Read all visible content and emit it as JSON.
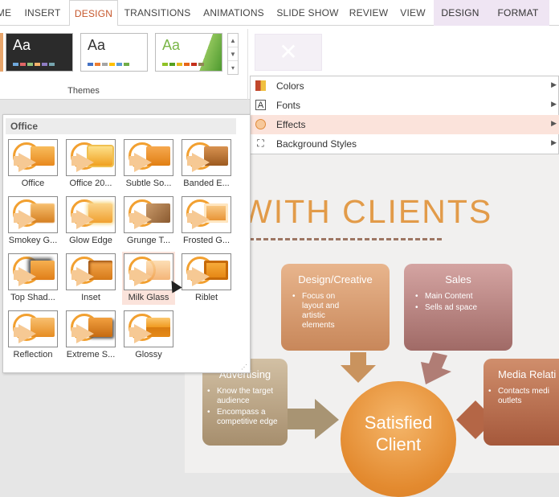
{
  "tabs": [
    {
      "label": "ME"
    },
    {
      "label": "INSERT"
    },
    {
      "label": "DESIGN"
    },
    {
      "label": "TRANSITIONS"
    },
    {
      "label": "ANIMATIONS"
    },
    {
      "label": "SLIDE SHOW"
    },
    {
      "label": "REVIEW"
    },
    {
      "label": "VIEW"
    },
    {
      "label": "DESIGN"
    },
    {
      "label": "FORMAT"
    }
  ],
  "themes": {
    "group_label": "Themes",
    "thumbs": [
      {
        "text": "Aa",
        "bg": "#2b2b2b",
        "fg": "#ffffff"
      },
      {
        "text": "Aa",
        "bg": "#ffffff",
        "fg": "#333333"
      },
      {
        "text": "Aa",
        "bg": "#ffffff",
        "fg": "#7ab648"
      }
    ],
    "scroll_up": "▲",
    "scroll_down": "▼",
    "scroll_more": "▾"
  },
  "menu": {
    "items": [
      {
        "label": "Colors",
        "icon": "colors-icon"
      },
      {
        "label": "Fonts",
        "icon": "fonts-icon"
      },
      {
        "label": "Effects",
        "icon": "effects-icon"
      },
      {
        "label": "Background Styles",
        "icon": "background-styles-icon"
      }
    ]
  },
  "gallery": {
    "header": "Office",
    "items": [
      {
        "label": "Office"
      },
      {
        "label": "Office 20..."
      },
      {
        "label": "Subtle So..."
      },
      {
        "label": "Banded E..."
      },
      {
        "label": "Smokey G..."
      },
      {
        "label": "Glow Edge"
      },
      {
        "label": "Grunge T..."
      },
      {
        "label": "Frosted G..."
      },
      {
        "label": "Top Shad..."
      },
      {
        "label": "Inset"
      },
      {
        "label": "Milk Glass"
      },
      {
        "label": "Riblet"
      },
      {
        "label": "Reflection"
      },
      {
        "label": "Extreme S..."
      },
      {
        "label": "Glossy"
      }
    ]
  },
  "slide": {
    "title": "WITH CLIENTS",
    "boxes": {
      "design": {
        "title": "Design/Creative",
        "bullets": [
          "Focus on layout and artistic elements"
        ]
      },
      "sales": {
        "title": "Sales",
        "bullets": [
          "Main Content",
          "Sells ad space"
        ]
      },
      "advertising": {
        "title": "Advertising",
        "bullets": [
          "Know the target audience",
          "Encompass a competitive edge"
        ]
      },
      "media": {
        "title": "Media Relati",
        "bullets": [
          "Contacts medi outlets"
        ]
      }
    },
    "center": {
      "line1": "Satisfied",
      "line2": "Client"
    }
  },
  "colors": {
    "accent": "#c6562b",
    "highlight": "#fbe3db",
    "orange": "#e38a2f",
    "brown": "#9d7663"
  }
}
